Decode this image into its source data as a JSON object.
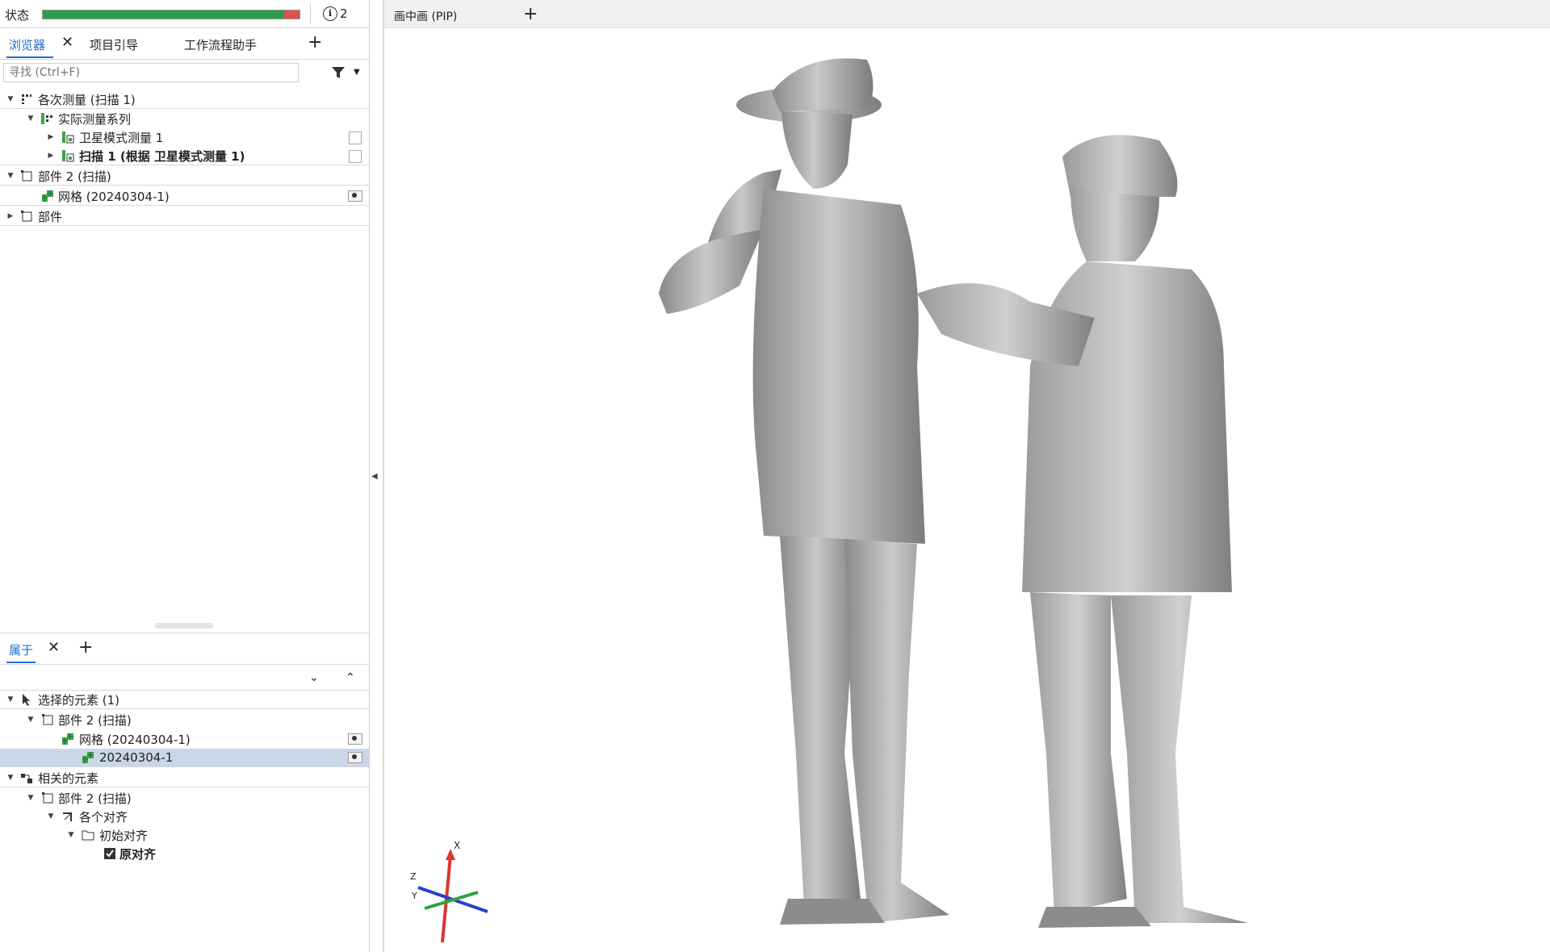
{
  "status": {
    "label": "状态",
    "info_count": "2",
    "progress_green_fraction": 0.94
  },
  "browser_tabs": {
    "browser": "浏览器",
    "project": "项目引导",
    "workflow": "工作流程助手"
  },
  "search": {
    "placeholder": "寻找 (Ctrl+F)"
  },
  "tree": {
    "measurements": "各次测量 (扫描 1)",
    "actual_series": "实际测量系列",
    "satellite": "卫星模式测量 1",
    "scan1": "扫描 1 (根据 卫星模式测量 1)",
    "part2": "部件 2 (扫描)",
    "mesh": "网格 (20240304-1)",
    "part": "部件"
  },
  "props_tabs": {
    "props": "属于"
  },
  "props_tree": {
    "selected": "选择的元素 (1)",
    "part2": "部件 2 (扫描)",
    "mesh": "网格 (20240304-1)",
    "mesh_item": "20240304-1",
    "related": "相关的元素",
    "related_part2": "部件 2 (扫描)",
    "alignments": "各个对齐",
    "initial_alignment": "初始对齐",
    "original_alignment": "原对齐"
  },
  "viewport": {
    "tab": "画中画 (PIP)"
  },
  "axis": {
    "x": "X",
    "y": "Y",
    "z": "Z"
  },
  "colors": {
    "accent": "#1e6fd0",
    "progress_ok": "#2e9d4a",
    "progress_err": "#d9534f",
    "selection": "#c9d7e8"
  }
}
